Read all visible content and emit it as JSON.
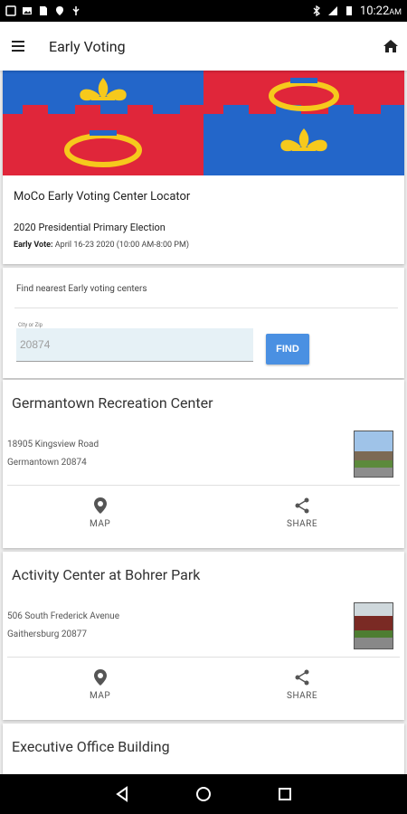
{
  "status": {
    "time": "10:22",
    "ampm": "AM"
  },
  "app_bar": {
    "title": "Early Voting"
  },
  "hero": {
    "title": "MoCo Early Voting Center Locator",
    "subtitle": "2020 Presidential Primary Election",
    "early_vote_label": "Early Vote:",
    "early_vote_dates": "April 16-23 2020 (10:00 AM-8:00 PM)"
  },
  "search": {
    "hint": "Find nearest Early voting centers",
    "field_label": "City or Zip",
    "field_value": "20874",
    "find_label": "FIND"
  },
  "locations": [
    {
      "name": "Germantown Recreation Center",
      "address1": "18905 Kingsview Road",
      "address2": "Germantown 20874",
      "map_label": "MAP",
      "share_label": "SHARE"
    },
    {
      "name": "Activity Center at Bohrer Park",
      "address1": "506 South Frederick Avenue",
      "address2": "Gaithersburg 20877",
      "map_label": "MAP",
      "share_label": "SHARE"
    },
    {
      "name": "Executive Office Building"
    }
  ],
  "colors": {
    "flag_red": "#e0263a",
    "flag_blue": "#2366c9",
    "flag_gold": "#f6c91c",
    "find_button": "#4a90e2"
  }
}
